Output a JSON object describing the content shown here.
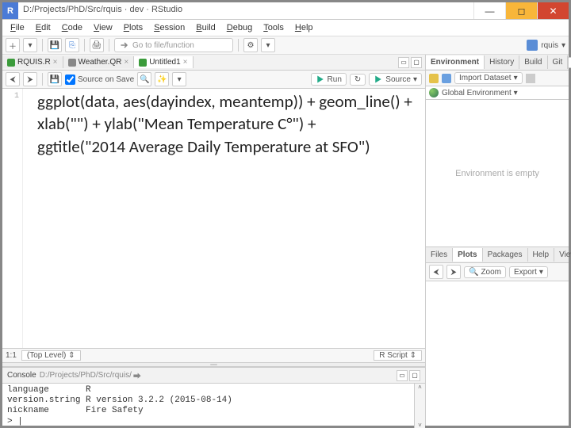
{
  "titlebar": {
    "appicon_text": "R",
    "title": "D:/Projects/PhD/Src/rquis · dev · RStudio"
  },
  "menubar": {
    "items": [
      "File",
      "Edit",
      "Code",
      "View",
      "Plots",
      "Session",
      "Build",
      "Debug",
      "Tools",
      "Help"
    ]
  },
  "maintoolbar": {
    "gotofile_placeholder": "Go to file/function",
    "project_label": "rquis"
  },
  "editor_tabs": {
    "items": [
      {
        "label": "RQUIS.R",
        "icon_color": "#3b9b3b"
      },
      {
        "label": "Weather.QR",
        "icon_color": "#888"
      },
      {
        "label": "Untitled1",
        "icon_color": "#3b9b3b",
        "active": true
      }
    ]
  },
  "editor_toolbar": {
    "source_on_save": "Source on Save",
    "run": "Run",
    "rerun_icon": "↻",
    "source": "Source"
  },
  "code": {
    "line1": "ggplot(data, aes(dayindex, meantemp)) + geom_line() +",
    "line2": " xlab(\"\") + ylab(\"Mean Temperature C°\") +",
    "line3": " ggtitle(\"2014 Average Daily Temperature at SFO\")",
    "gutter_start": "1"
  },
  "statusbar": {
    "pos": "1:1",
    "scope": "(Top Level)",
    "lang": "R Script"
  },
  "console": {
    "title": "Console",
    "path": "D:/Projects/PhD/Src/rquis/",
    "lines": "language       R\nversion.string R version 3.2.2 (2015-08-14)\nnickname       Fire Safety\n> |"
  },
  "env_pane": {
    "tabs": [
      "Environment",
      "History",
      "Build",
      "Git"
    ],
    "active_tab": "Environment",
    "import_label": "Import Dataset",
    "scope_label": "Global Environment",
    "empty_text": "Environment is empty"
  },
  "plots_pane": {
    "tabs": [
      "Files",
      "Plots",
      "Packages",
      "Help",
      "Viewer"
    ],
    "active_tab": "Plots",
    "zoom": "Zoom",
    "export": "Export"
  }
}
